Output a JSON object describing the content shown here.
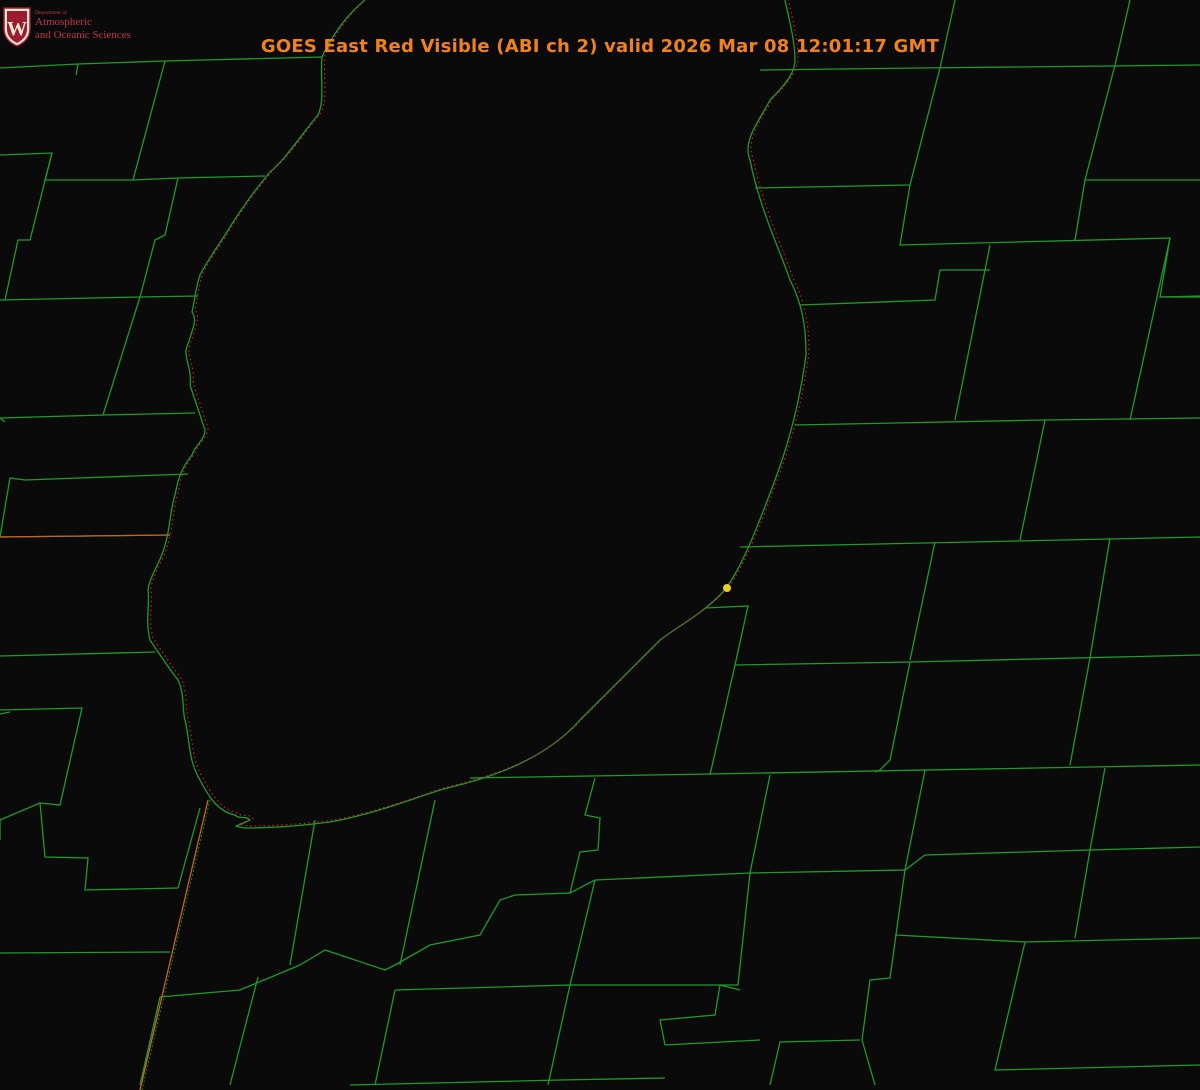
{
  "title": "GOES East Red Visible (ABI ch 2) valid 2026 Mar 08 12:01:17 GMT",
  "logo": {
    "dept": "Department of",
    "line1": "Atmospheric",
    "line2": "and Oceanic Sciences",
    "shield_letter": "W"
  },
  "colors": {
    "background": "#0a0a0a",
    "county_lines": "#1f9a2a",
    "shoreline_dots": "#d21e1e",
    "state_border": "#c8641e",
    "title": "#f0821e",
    "marker": "#e6d21e",
    "logo": "#c0394b"
  }
}
